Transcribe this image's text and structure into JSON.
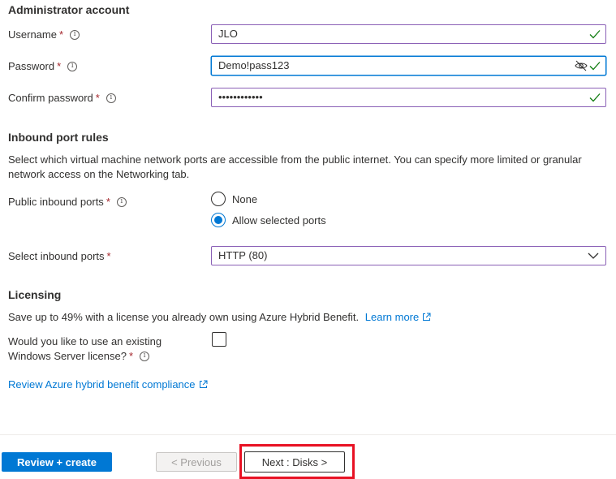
{
  "admin": {
    "title": "Administrator account",
    "username_label": "Username",
    "username_value": "JLO",
    "password_label": "Password",
    "password_value": "Demo!pass123",
    "confirm_label": "Confirm password",
    "confirm_value": "••••••••••••",
    "required_mark": "*",
    "info_glyph": "i"
  },
  "inbound": {
    "title": "Inbound port rules",
    "description": "Select which virtual machine network ports are accessible from the public internet. You can specify more limited or granular network access on the Networking tab.",
    "public_label": "Public inbound ports",
    "options": [
      "None",
      "Allow selected ports"
    ],
    "selected_option": "Allow selected ports",
    "select_label": "Select inbound ports",
    "select_value": "HTTP (80)"
  },
  "licensing": {
    "title": "Licensing",
    "description": "Save up to 49% with a license you already own using Azure Hybrid Benefit.",
    "learn_more": "Learn more",
    "question_line1": "Would you like to use an existing",
    "question_line2": "Windows Server license?",
    "checkbox_checked": false,
    "review_link": "Review Azure hybrid benefit compliance"
  },
  "footer": {
    "review_create": "Review + create",
    "previous": "< Previous",
    "next": "Next : Disks >"
  },
  "colors": {
    "accent": "#0078d4",
    "required": "#a4262c",
    "valid_check": "#107c10",
    "input_border": "#8a60b6",
    "highlight": "#e81123"
  },
  "icons": [
    "info-icon",
    "check-icon",
    "eye-slash-icon",
    "chevron-down-icon",
    "external-link-icon"
  ]
}
